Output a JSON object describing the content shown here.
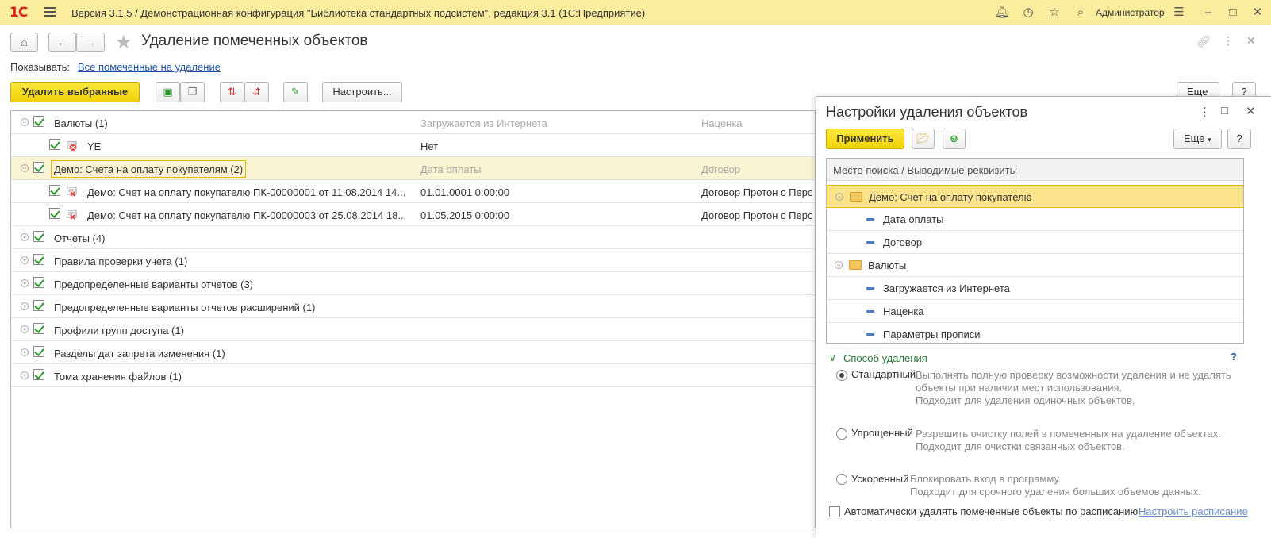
{
  "window": {
    "title": "Версия 3.1.5 / Демонстрационная конфигурация \"Библиотека стандартных подсистем\", редакция 3.1  (1С:Предприятие)",
    "logo": "1С",
    "user": "Администратор",
    "icons": [
      "bell-icon",
      "history-icon",
      "star-icon",
      "search-icon",
      "menu-icon",
      "minimize-icon",
      "maximize-icon",
      "close-icon"
    ]
  },
  "form": {
    "title": "Удаление помеченных объектов",
    "show_label": "Показывать:",
    "show_link": "Все помеченные на удаление",
    "toolbar": {
      "delete_selected": "Удалить выбранные",
      "configure": "Настроить...",
      "more": "Еще"
    }
  },
  "grid": {
    "rows": [
      {
        "label": "Валюты (1)",
        "col2": "Загружается из Интернета",
        "col3": "Наценка"
      },
      {
        "label": "YE",
        "col2": "Нет",
        "col3": ""
      },
      {
        "label": "Демо: Счета на оплату покупателям (2)",
        "col2": "Дата оплаты",
        "col3": "Договор"
      },
      {
        "label": "Демо: Счет на оплату покупателю ПК-00000001 от 11.08.2014 14...",
        "col2": "01.01.0001 0:00:00",
        "col3": "Договор Протон с Перс"
      },
      {
        "label": "Демо: Счет на оплату покупателю ПК-00000003 от 25.08.2014 18...",
        "col2": "01.05.2015 0:00:00",
        "col3": "Договор Протон с Перс"
      },
      {
        "label": "Отчеты (4)"
      },
      {
        "label": "Правила проверки учета (1)"
      },
      {
        "label": "Предопределенные варианты отчетов (3)"
      },
      {
        "label": "Предопределенные варианты отчетов расширений (1)"
      },
      {
        "label": "Профили групп доступа (1)"
      },
      {
        "label": "Разделы дат запрета изменения (1)"
      },
      {
        "label": "Тома хранения файлов (1)"
      }
    ]
  },
  "panel": {
    "title": "Настройки удаления объектов",
    "apply": "Применить",
    "more": "Еще",
    "help": "?",
    "tree_header": "Место поиска / Выводимые реквизиты",
    "tree": [
      {
        "label": "Демо: Счет на оплату покупателю",
        "kind": "folder"
      },
      {
        "label": "Дата оплаты",
        "kind": "field"
      },
      {
        "label": "Договор",
        "kind": "field"
      },
      {
        "label": "Валюты",
        "kind": "folder"
      },
      {
        "label": "Загружается из Интернета",
        "kind": "field"
      },
      {
        "label": "Наценка",
        "kind": "field"
      },
      {
        "label": "Параметры прописи",
        "kind": "field"
      }
    ],
    "method_title": "Способ удаления",
    "method_help": "?",
    "methods": [
      {
        "label": "Стандартный",
        "desc1": "Выполнять полную проверку возможности удаления и не удалять",
        "desc2": "объекты при наличии мест использования.",
        "desc3": "Подходит для удаления одиночных объектов.",
        "selected": true
      },
      {
        "label": "Упрощенный",
        "desc1": "Разрешить очистку полей в помеченных на удаление объектах.",
        "desc2": "Подходит для очистки связанных объектов.",
        "selected": false
      },
      {
        "label": "Ускоренный",
        "desc1": "Блокировать вход в программу.",
        "desc2": "Подходит для срочного удаления больших объемов данных.",
        "selected": false
      }
    ],
    "auto_delete": "Автоматически удалять помеченные объекты по расписанию",
    "schedule_link": "Настроить расписание"
  }
}
